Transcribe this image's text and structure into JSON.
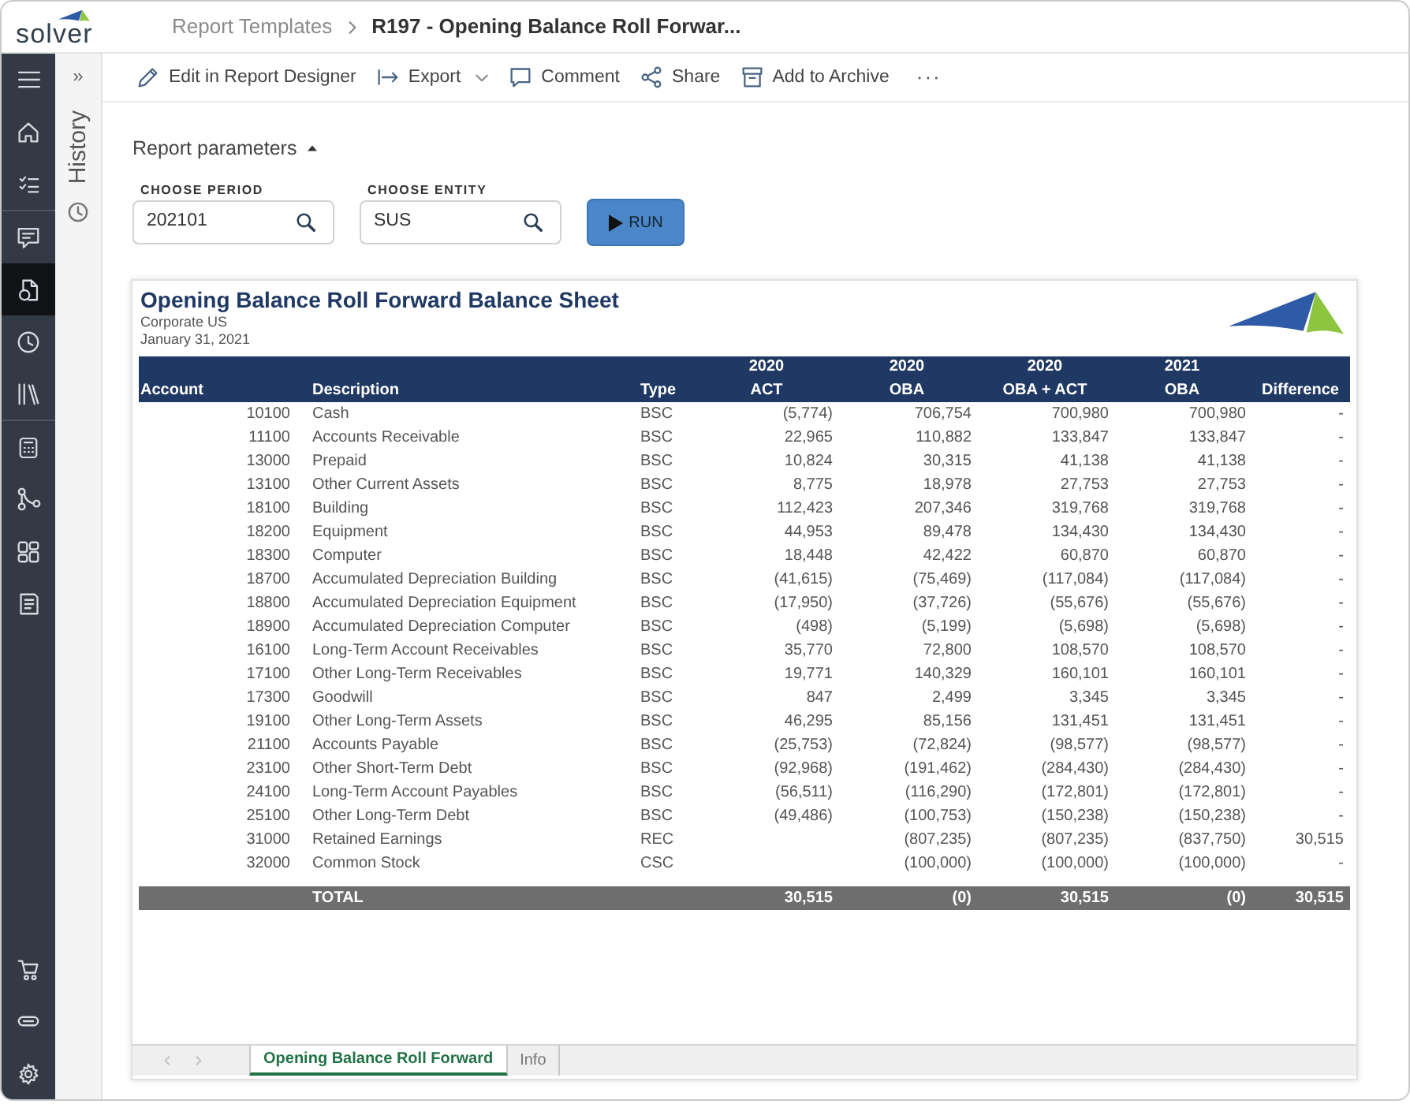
{
  "header": {
    "logo": "solver",
    "breadcrumb": [
      {
        "label": "Report Templates",
        "current": false
      },
      {
        "label": "R197 - Opening Balance Roll Forwar...",
        "current": true
      }
    ]
  },
  "nav_rail": {
    "sections": [
      {
        "items": [
          {
            "selected": false
          },
          {
            "selected": false
          },
          {
            "selected": false
          }
        ]
      },
      {
        "items": [
          {
            "selected": false
          },
          {
            "selected": true
          },
          {
            "selected": false
          },
          {
            "selected": false
          }
        ]
      },
      {
        "items": [
          {
            "selected": false
          },
          {
            "selected": false
          },
          {
            "selected": false
          },
          {
            "selected": false
          }
        ]
      }
    ],
    "bottom_items": [
      {
        "selected": false
      },
      {
        "selected": false
      },
      {
        "selected": false
      }
    ]
  },
  "history_panel": {
    "expand": "»",
    "title": "History"
  },
  "toolbar": {
    "actions": [
      {
        "label": "Edit in Report Designer",
        "has_menu": false
      },
      {
        "label": "Export",
        "has_menu": true
      },
      {
        "label": "Comment",
        "has_menu": false
      },
      {
        "label": "Share",
        "has_menu": false
      },
      {
        "label": "Add to Archive",
        "has_menu": false
      }
    ],
    "more": "···"
  },
  "parameters": {
    "title": "Report parameters",
    "expanded": true,
    "fields": [
      {
        "label": "CHOOSE PERIOD",
        "value": "202101"
      },
      {
        "label": "CHOOSE ENTITY",
        "value": "SUS"
      }
    ],
    "run_button": "RUN"
  },
  "report": {
    "title": "Opening Balance Roll Forward Balance Sheet",
    "entity": "Corporate US",
    "date": "January 31, 2021",
    "columns": [
      {
        "label": "Account"
      },
      {
        "label": "Description"
      },
      {
        "label": "Type"
      },
      {
        "year": "2020",
        "label": "ACT"
      },
      {
        "year": "2020",
        "label": "OBA"
      },
      {
        "year": "2020",
        "label": "OBA + ACT"
      },
      {
        "year": "2021",
        "label": "OBA"
      },
      {
        "label": "Difference"
      }
    ],
    "rows": [
      {
        "account": "10100",
        "description": "Cash",
        "type": "BSC",
        "act_2020": "(5,774)",
        "oba_2020": "706,754",
        "oba_act_2020": "700,980",
        "oba_2021": "700,980",
        "difference": "-"
      },
      {
        "account": "11100",
        "description": "Accounts Receivable",
        "type": "BSC",
        "act_2020": "22,965",
        "oba_2020": "110,882",
        "oba_act_2020": "133,847",
        "oba_2021": "133,847",
        "difference": "-"
      },
      {
        "account": "13000",
        "description": "Prepaid",
        "type": "BSC",
        "act_2020": "10,824",
        "oba_2020": "30,315",
        "oba_act_2020": "41,138",
        "oba_2021": "41,138",
        "difference": "-"
      },
      {
        "account": "13100",
        "description": "Other Current Assets",
        "type": "BSC",
        "act_2020": "8,775",
        "oba_2020": "18,978",
        "oba_act_2020": "27,753",
        "oba_2021": "27,753",
        "difference": "-"
      },
      {
        "account": "18100",
        "description": "Building",
        "type": "BSC",
        "act_2020": "112,423",
        "oba_2020": "207,346",
        "oba_act_2020": "319,768",
        "oba_2021": "319,768",
        "difference": "-"
      },
      {
        "account": "18200",
        "description": "Equipment",
        "type": "BSC",
        "act_2020": "44,953",
        "oba_2020": "89,478",
        "oba_act_2020": "134,430",
        "oba_2021": "134,430",
        "difference": "-"
      },
      {
        "account": "18300",
        "description": "Computer",
        "type": "BSC",
        "act_2020": "18,448",
        "oba_2020": "42,422",
        "oba_act_2020": "60,870",
        "oba_2021": "60,870",
        "difference": "-"
      },
      {
        "account": "18700",
        "description": "Accumulated Depreciation Building",
        "type": "BSC",
        "act_2020": "(41,615)",
        "oba_2020": "(75,469)",
        "oba_act_2020": "(117,084)",
        "oba_2021": "(117,084)",
        "difference": "-"
      },
      {
        "account": "18800",
        "description": "Accumulated Depreciation Equipment",
        "type": "BSC",
        "act_2020": "(17,950)",
        "oba_2020": "(37,726)",
        "oba_act_2020": "(55,676)",
        "oba_2021": "(55,676)",
        "difference": "-"
      },
      {
        "account": "18900",
        "description": "Accumulated Depreciation Computer",
        "type": "BSC",
        "act_2020": "(498)",
        "oba_2020": "(5,199)",
        "oba_act_2020": "(5,698)",
        "oba_2021": "(5,698)",
        "difference": "-"
      },
      {
        "account": "16100",
        "description": "Long-Term Account Receivables",
        "type": "BSC",
        "act_2020": "35,770",
        "oba_2020": "72,800",
        "oba_act_2020": "108,570",
        "oba_2021": "108,570",
        "difference": "-"
      },
      {
        "account": "17100",
        "description": "Other Long-Term Receivables",
        "type": "BSC",
        "act_2020": "19,771",
        "oba_2020": "140,329",
        "oba_act_2020": "160,101",
        "oba_2021": "160,101",
        "difference": "-"
      },
      {
        "account": "17300",
        "description": "Goodwill",
        "type": "BSC",
        "act_2020": "847",
        "oba_2020": "2,499",
        "oba_act_2020": "3,345",
        "oba_2021": "3,345",
        "difference": "-"
      },
      {
        "account": "19100",
        "description": "Other Long-Term Assets",
        "type": "BSC",
        "act_2020": "46,295",
        "oba_2020": "85,156",
        "oba_act_2020": "131,451",
        "oba_2021": "131,451",
        "difference": "-"
      },
      {
        "account": "21100",
        "description": "Accounts Payable",
        "type": "BSC",
        "act_2020": "(25,753)",
        "oba_2020": "(72,824)",
        "oba_act_2020": "(98,577)",
        "oba_2021": "(98,577)",
        "difference": "-"
      },
      {
        "account": "23100",
        "description": "Other Short-Term Debt",
        "type": "BSC",
        "act_2020": "(92,968)",
        "oba_2020": "(191,462)",
        "oba_act_2020": "(284,430)",
        "oba_2021": "(284,430)",
        "difference": "-"
      },
      {
        "account": "24100",
        "description": "Long-Term Account Payables",
        "type": "BSC",
        "act_2020": "(56,511)",
        "oba_2020": "(116,290)",
        "oba_act_2020": "(172,801)",
        "oba_2021": "(172,801)",
        "difference": "-"
      },
      {
        "account": "25100",
        "description": "Other Long-Term Debt",
        "type": "BSC",
        "act_2020": "(49,486)",
        "oba_2020": "(100,753)",
        "oba_act_2020": "(150,238)",
        "oba_2021": "(150,238)",
        "difference": "-"
      },
      {
        "account": "31000",
        "description": "Retained Earnings",
        "type": "REC",
        "oba_2020": "(807,235)",
        "oba_act_2020": "(807,235)",
        "oba_2021": "(837,750)",
        "difference": "30,515"
      },
      {
        "account": "32000",
        "description": "Common Stock",
        "type": "CSC",
        "oba_2020": "(100,000)",
        "oba_act_2020": "(100,000)",
        "oba_2021": "(100,000)",
        "difference": "-"
      }
    ],
    "total": {
      "label": "TOTAL",
      "act_2020": "30,515",
      "oba_2020": "(0)",
      "oba_act_2020": "30,515",
      "oba_2021": "(0)",
      "difference": "30,515"
    }
  },
  "sheet_tabs": [
    {
      "label": "Opening Balance Roll Forward",
      "selected": true
    },
    {
      "label": "Info",
      "selected": false
    }
  ]
}
